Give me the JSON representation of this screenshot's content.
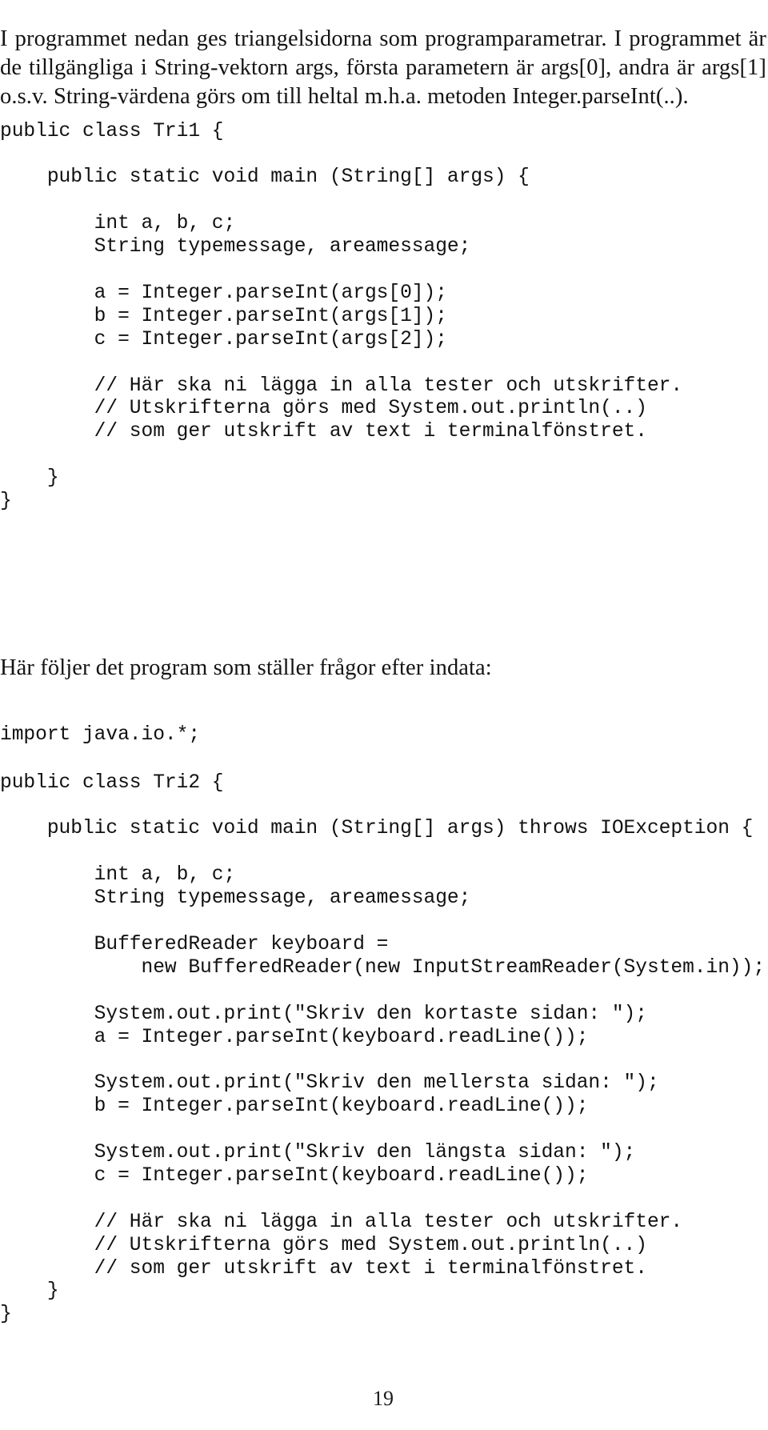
{
  "document": {
    "page_number": "19",
    "language": "sv"
  },
  "intro_paragraph": {
    "text": "I programmet nedan ges triangelsidorna som programparametrar. I programmet är de tillgängliga i String-vektorn args, första parametern är args[0], andra är args[1] o.s.v. String-värdena görs om till heltal m.h.a. metoden Integer.parseInt(..)."
  },
  "code_block_tri1": {
    "language": "java",
    "class_name": "Tri1",
    "lines": [
      "public class Tri1 {",
      "",
      "    public static void main (String[] args) {",
      "",
      "        int a, b, c;",
      "        String typemessage, areamessage;",
      "",
      "        a = Integer.parseInt(args[0]);",
      "        b = Integer.parseInt(args[1]);",
      "        c = Integer.parseInt(args[2]);",
      "",
      "        // Här ska ni lägga in alla tester och utskrifter.",
      "        // Utskrifterna görs med System.out.println(..)",
      "        // som ger utskrift av text i terminalfönstret.",
      "",
      "    }",
      "}"
    ]
  },
  "followup_paragraph": {
    "text": "Här följer det program som ställer frågor efter indata:"
  },
  "code_block_import": {
    "language": "java",
    "lines": [
      "import java.io.*;"
    ]
  },
  "code_block_tri2": {
    "language": "java",
    "class_name": "Tri2",
    "lines": [
      "public class Tri2 {",
      "",
      "    public static void main (String[] args) throws IOException {",
      "",
      "        int a, b, c;",
      "        String typemessage, areamessage;",
      "",
      "        BufferedReader keyboard =",
      "            new BufferedReader(new InputStreamReader(System.in));",
      "",
      "        System.out.print(\"Skriv den kortaste sidan: \");",
      "        a = Integer.parseInt(keyboard.readLine());",
      "",
      "        System.out.print(\"Skriv den mellersta sidan: \");",
      "        b = Integer.parseInt(keyboard.readLine());",
      "",
      "        System.out.print(\"Skriv den längsta sidan: \");",
      "        c = Integer.parseInt(keyboard.readLine());",
      "",
      "        // Här ska ni lägga in alla tester och utskrifter.",
      "        // Utskrifterna görs med System.out.println(..)",
      "        // som ger utskrift av text i terminalfönstret.",
      "    }",
      "}"
    ]
  }
}
